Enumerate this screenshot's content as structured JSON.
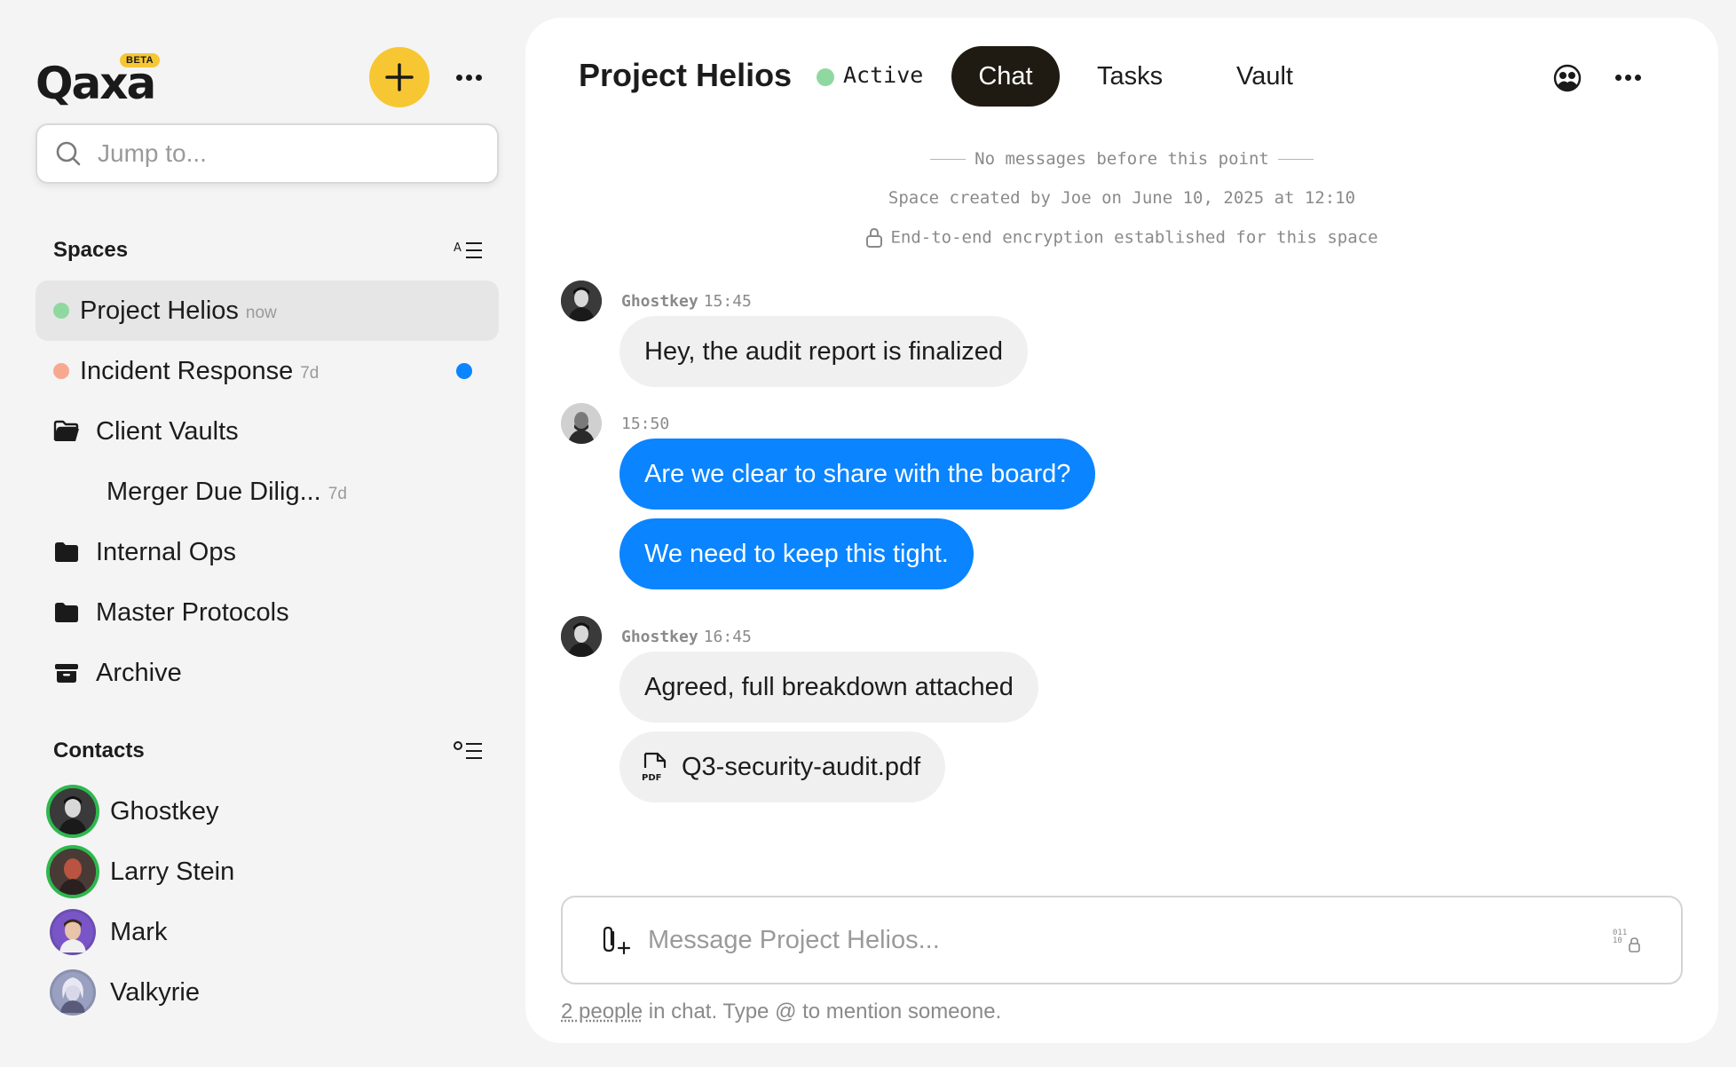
{
  "app": {
    "logo_text": "Qaxa",
    "beta_badge": "BETA"
  },
  "search": {
    "placeholder": "Jump to..."
  },
  "sidebar": {
    "spaces_title": "Spaces",
    "contacts_title": "Contacts",
    "spaces": [
      {
        "label": "Project Helios",
        "time": "now",
        "status_color": "#8fd9a0",
        "active": true,
        "unread": false
      },
      {
        "label": "Incident Response",
        "time": "7d",
        "status_color": "#f7a98f",
        "active": false,
        "unread": true
      }
    ],
    "folders": [
      {
        "label": "Client Vaults",
        "icon": "folder-open-icon"
      },
      {
        "label": "Merger Due Dilig...",
        "time": "7d",
        "nested": true
      },
      {
        "label": "Internal Ops",
        "icon": "folder-icon"
      },
      {
        "label": "Master Protocols",
        "icon": "folder-icon"
      },
      {
        "label": "Archive",
        "icon": "archive-icon"
      }
    ],
    "contacts": [
      {
        "name": "Ghostkey",
        "online": true
      },
      {
        "name": "Larry Stein",
        "online": true
      },
      {
        "name": "Mark",
        "online": false
      },
      {
        "name": "Valkyrie",
        "online": false
      }
    ]
  },
  "header": {
    "title": "Project Helios",
    "status": "Active",
    "tabs": [
      "Chat",
      "Tasks",
      "Vault"
    ],
    "active_tab": "Chat"
  },
  "chat": {
    "system": {
      "start": "No messages before this point",
      "created": "Space created by Joe on June 10, 2025 at 12:10",
      "encryption": "End-to-end encryption established for this space"
    },
    "messages": [
      {
        "author": "Ghostkey",
        "time": "15:45",
        "text": "Hey, the audit report is finalized",
        "direction": "in"
      },
      {
        "author": "",
        "time": "15:50",
        "text": "Are we clear to share with the board?",
        "direction": "out"
      },
      {
        "author": "",
        "time": "",
        "text": "We need to keep this tight.",
        "direction": "out"
      },
      {
        "author": "Ghostkey",
        "time": "16:45",
        "text": "Agreed, full breakdown attached",
        "direction": "in"
      },
      {
        "attachment": "Q3-security-audit.pdf"
      }
    ]
  },
  "composer": {
    "placeholder": "Message Project Helios...",
    "hint_link": "2 people",
    "hint_rest": " in chat. Type @ to mention someone."
  },
  "colors": {
    "accent_yellow": "#f7c733",
    "bubble_blue": "#0a84ff",
    "active_tab_bg": "#1f1a12",
    "online_green": "#2db84d"
  }
}
